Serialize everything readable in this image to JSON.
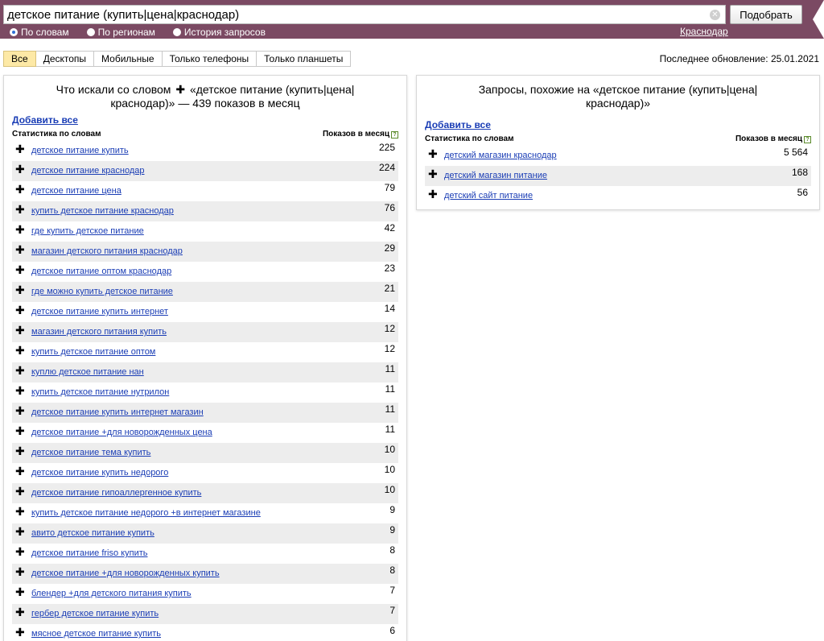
{
  "search": {
    "query": "детское питание (купить|цена|краснодар)",
    "submit_label": "Подобрать",
    "modes": [
      {
        "label": "По словам",
        "checked": true
      },
      {
        "label": "По регионам",
        "checked": false
      },
      {
        "label": "История запросов",
        "checked": false
      }
    ],
    "region": "Краснодар"
  },
  "device_tabs": [
    "Все",
    "Десктопы",
    "Мобильные",
    "Только телефоны",
    "Только планшеты"
  ],
  "active_tab": "Все",
  "last_update": "Последнее обновление: 25.01.2021",
  "left_panel": {
    "title_pre": "Что искали со словом",
    "title_post": "«детское питание (купить|цена|краснодар)» — 439 показов в месяц",
    "add_all": "Добавить все",
    "col_keyword": "Статистика по словам",
    "col_count": "Показов в месяц",
    "rows": [
      {
        "phrase": "детское питание купить",
        "count": "225"
      },
      {
        "phrase": "детское питание краснодар",
        "count": "224"
      },
      {
        "phrase": "детское питание цена",
        "count": "79"
      },
      {
        "phrase": "купить детское питание краснодар",
        "count": "76"
      },
      {
        "phrase": "где купить детское питание",
        "count": "42"
      },
      {
        "phrase": "магазин детского питания краснодар",
        "count": "29"
      },
      {
        "phrase": "детское питание оптом краснодар",
        "count": "23"
      },
      {
        "phrase": "где можно купить детское питание",
        "count": "21"
      },
      {
        "phrase": "детское питание купить интернет",
        "count": "14"
      },
      {
        "phrase": "магазин детского питания купить",
        "count": "12"
      },
      {
        "phrase": "купить детское питание оптом",
        "count": "12"
      },
      {
        "phrase": "куплю детское питание нан",
        "count": "11"
      },
      {
        "phrase": "купить детское питание нутрилон",
        "count": "11"
      },
      {
        "phrase": "детское питание купить интернет магазин",
        "count": "11"
      },
      {
        "phrase": "детское питание +для новорожденных цена",
        "count": "11"
      },
      {
        "phrase": "детское питание тема купить",
        "count": "10"
      },
      {
        "phrase": "детское питание купить недорого",
        "count": "10"
      },
      {
        "phrase": "детское питание гипоаллергенное купить",
        "count": "10"
      },
      {
        "phrase": "купить детское питание недорого +в интернет магазине",
        "count": "9"
      },
      {
        "phrase": "авито детское питание купить",
        "count": "9"
      },
      {
        "phrase": "детское питание friso купить",
        "count": "8"
      },
      {
        "phrase": "детское питание +для новорожденных купить",
        "count": "8"
      },
      {
        "phrase": "блендер +для детского питания купить",
        "count": "7"
      },
      {
        "phrase": "гербер детское питание купить",
        "count": "7"
      },
      {
        "phrase": "мясное детское питание купить",
        "count": "6"
      }
    ]
  },
  "right_panel": {
    "title": "Запросы, похожие на «детское питание (купить|цена|краснодар)»",
    "add_all": "Добавить все",
    "col_keyword": "Статистика по словам",
    "col_count": "Показов в месяц",
    "rows": [
      {
        "phrase": "детский магазин краснодар",
        "count": "5 564"
      },
      {
        "phrase": "детский магазин питание",
        "count": "168"
      },
      {
        "phrase": "детский сайт питание",
        "count": "56"
      }
    ]
  },
  "icons": {
    "clear": "clear-icon",
    "add": "plus-icon",
    "help": "help-icon"
  },
  "colors": {
    "header_bg": "#7b4a63",
    "link": "#1a3db5",
    "active_tab": "#fde9a6",
    "row_alt": "#ededed"
  }
}
